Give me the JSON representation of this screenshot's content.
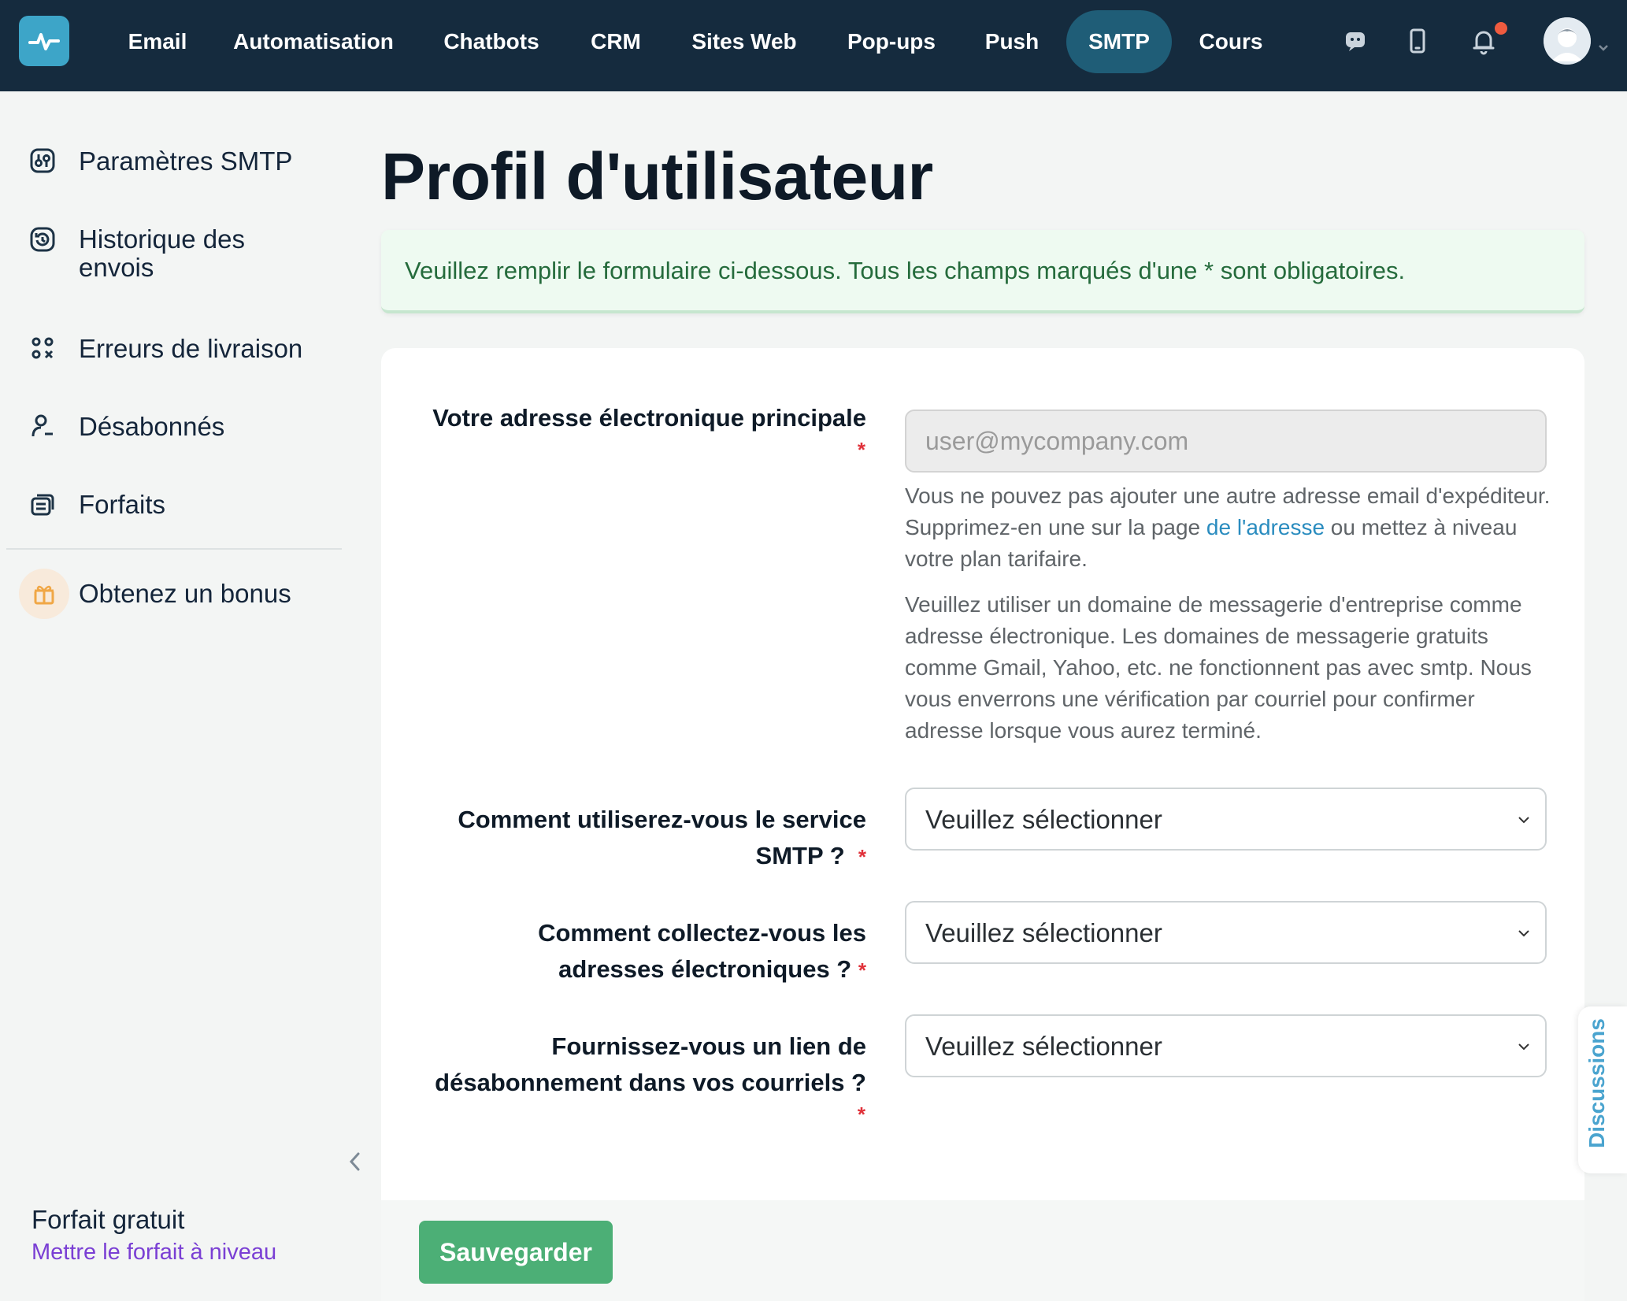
{
  "nav": {
    "items": [
      {
        "label": "Email"
      },
      {
        "label": "Automatisation"
      },
      {
        "label": "Chatbots"
      },
      {
        "label": "CRM"
      },
      {
        "label": "Sites Web"
      },
      {
        "label": "Pop-ups"
      },
      {
        "label": "Push"
      },
      {
        "label": "SMTP",
        "active": true
      },
      {
        "label": "Cours"
      }
    ],
    "icons": [
      "chat-icon",
      "mobile-icon",
      "bell-icon",
      "avatar"
    ],
    "notification_dot_color": "#ef5b3f"
  },
  "sidebar": {
    "items": [
      {
        "label": "Paramètres SMTP",
        "icon": "settings-sliders-icon"
      },
      {
        "label": "Historique des envois",
        "icon": "history-icon"
      },
      {
        "label": "Erreurs de livraison",
        "icon": "delivery-errors-icon"
      },
      {
        "label": "Désabonnés",
        "icon": "unsubscribed-user-icon"
      },
      {
        "label": "Forfaits",
        "icon": "plans-icon"
      }
    ],
    "bonus": {
      "label": "Obtenez un bonus",
      "icon": "gift-icon"
    },
    "plan": {
      "name": "Forfait gratuit",
      "upgrade_label": "Mettre le forfait à niveau"
    }
  },
  "main": {
    "title": "Profil d'utilisateur",
    "notice": "Veuillez remplir le formulaire ci-dessous. Tous les champs marqués d'une * sont obligatoires.",
    "fields": {
      "email": {
        "label": "Votre adresse électronique principale",
        "placeholder": "user@mycompany.com",
        "help1_before": "Vous ne pouvez pas ajouter une autre adresse email d'expéditeur. Supprimez-en une sur la page ",
        "help1_link": "de l'adresse",
        "help1_after": " ou mettez à niveau votre plan tarifaire.",
        "help2": "Veuillez utiliser un domaine de messagerie d'entreprise comme adresse électronique. Les domaines de messagerie gratuits comme Gmail, Yahoo, etc. ne fonctionnent pas avec smtp. Nous vous enverrons une vérification par courriel pour confirmer adresse lorsque vous aurez terminé."
      },
      "usage": {
        "label_line1": "Comment utiliserez-vous le service",
        "label_line2": "SMTP ?",
        "value": "Veuillez sélectionner"
      },
      "collection": {
        "label_line1": "Comment collectez-vous les",
        "label_line2": "adresses électroniques ?",
        "value": "Veuillez sélectionner"
      },
      "unsubscribe": {
        "label_line1": "Fournissez-vous un lien de",
        "label_line2": "désabonnement dans vos courriels ?",
        "value": "Veuillez sélectionner"
      },
      "required_mark": "*"
    },
    "save_label": "Sauvegarder"
  },
  "discussions_label": "Discussions",
  "colors": {
    "topbar": "#152b3e",
    "active_tab": "#1f5d77",
    "accent": "#3da5c8",
    "save_button": "#4caf76",
    "notice_bg": "#eefaf1",
    "notice_text": "#256b3c",
    "upgrade_link": "#7a3fd4",
    "required": "#e0313a"
  }
}
